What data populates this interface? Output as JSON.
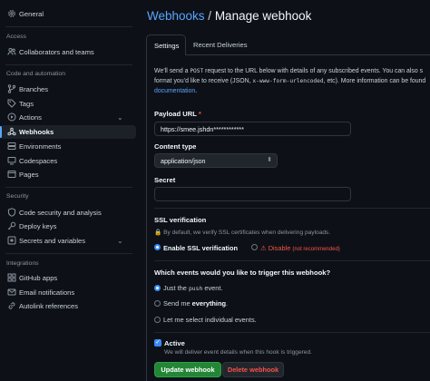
{
  "sidebar": {
    "general": "General",
    "sections": {
      "access": "Access",
      "code_automation": "Code and automation",
      "security": "Security",
      "integrations": "Integrations"
    },
    "items": [
      {
        "label": "Collaborators and teams",
        "icon": "people-icon"
      },
      {
        "label": "Branches",
        "icon": "branch-icon"
      },
      {
        "label": "Tags",
        "icon": "tag-icon"
      },
      {
        "label": "Actions",
        "icon": "play-icon"
      },
      {
        "label": "Webhooks",
        "icon": "webhook-icon"
      },
      {
        "label": "Environments",
        "icon": "server-icon"
      },
      {
        "label": "Codespaces",
        "icon": "codespaces-icon"
      },
      {
        "label": "Pages",
        "icon": "browser-icon"
      },
      {
        "label": "Code security and analysis",
        "icon": "shield-icon"
      },
      {
        "label": "Deploy keys",
        "icon": "key-icon"
      },
      {
        "label": "Secrets and variables",
        "icon": "asterisk-icon"
      },
      {
        "label": "GitHub apps",
        "icon": "apps-icon"
      },
      {
        "label": "Email notifications",
        "icon": "mail-icon"
      },
      {
        "label": "Autolink references",
        "icon": "link-icon"
      }
    ],
    "active": "Webhooks"
  },
  "header": {
    "breadcrumb_link": "Webhooks",
    "separator": " / ",
    "title": "Manage webhook"
  },
  "tabs": [
    {
      "label": "Settings",
      "active": true
    },
    {
      "label": "Recent Deliveries",
      "active": false
    }
  ],
  "intro": {
    "line1_a": "We’ll send a ",
    "line1_code": "POST",
    "line1_b": " request to the URL below with details of any subscribed events. You can also s",
    "line2_a": "format you’d like to receive (JSON, ",
    "line2_code": "x-www-form-urlencoded",
    "line2_b": ", etc). More information can be found",
    "line3_link": "documentation",
    "line3_b": "."
  },
  "form": {
    "payload_url": {
      "label": "Payload URL",
      "required": "*",
      "value": "https://smee.jshdn************"
    },
    "content_type": {
      "label": "Content type",
      "value": "application/json"
    },
    "secret": {
      "label": "Secret",
      "value": ""
    },
    "ssl": {
      "label": "SSL verification",
      "note": "By default, we verify SSL certificates when delivering payloads.",
      "enable_label": "Enable SSL verification",
      "disable_label": "Disable",
      "disable_note": "(not recommended)",
      "selected": "enable"
    },
    "events": {
      "question": "Which events would you like to trigger this webhook?",
      "opt1_a": "Just the ",
      "opt1_code": "push",
      "opt1_b": " event.",
      "opt2_a": "Send me ",
      "opt2_b": "everything",
      "opt2_c": ".",
      "opt3": "Let me select individual events.",
      "selected": "push"
    },
    "active": {
      "label": "Active",
      "note": "We will deliver event details when this hook is triggered.",
      "checked": true
    },
    "buttons": {
      "update": "Update webhook",
      "delete": "Delete webhook"
    }
  },
  "colors": {
    "background": "#0d1117",
    "accent": "#58a6ff",
    "green": "#238636",
    "danger": "#f85149"
  }
}
